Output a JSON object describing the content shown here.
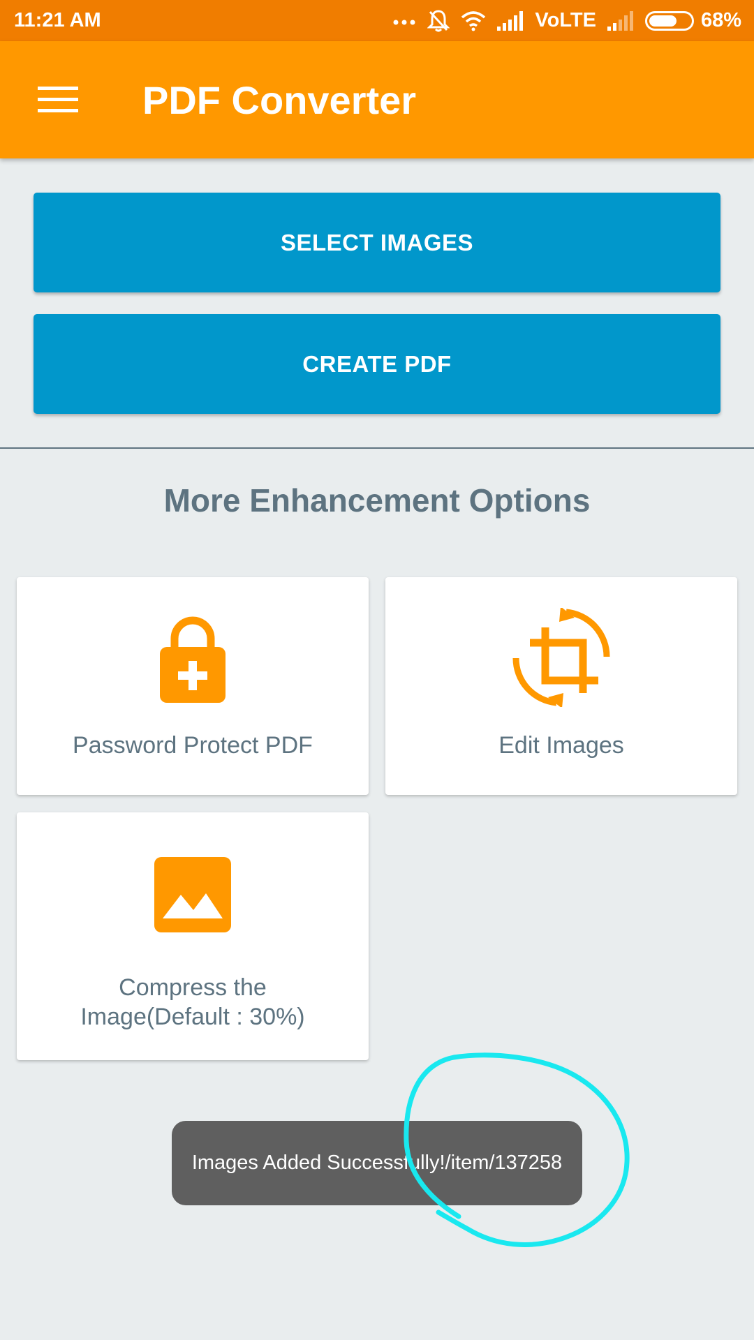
{
  "status_bar": {
    "time": "11:21 AM",
    "network": "VoLTE",
    "battery_percent": "68%",
    "battery_level": 0.68,
    "icons": [
      "more-dots-icon",
      "notifications-off-icon",
      "wifi-icon",
      "signal-icon",
      "signal-weak-icon",
      "battery-icon"
    ]
  },
  "app_bar": {
    "title": "PDF Converter",
    "menu_icon": "hamburger-menu-icon"
  },
  "actions": {
    "select_images": "SELECT IMAGES",
    "create_pdf": "CREATE PDF"
  },
  "enhancements": {
    "title": "More Enhancement Options",
    "options": [
      {
        "label": "Password Protect PDF",
        "icon": "lock-plus-icon"
      },
      {
        "label": "Edit Images",
        "icon": "crop-rotate-icon"
      },
      {
        "label": "Compress the Image(Default : 30%)",
        "icon": "image-icon"
      }
    ]
  },
  "toast": {
    "message": "Images Added Successfully!/item/137258"
  },
  "colors": {
    "status_bar": "#f07d00",
    "app_bar": "#ff9800",
    "primary_button": "#0197cb",
    "icon_accent": "#ff9800",
    "text_muted": "#5d7380",
    "background": "#e9edee",
    "toast_bg": "#5f5f5f",
    "annotation": "#19e8ef"
  }
}
